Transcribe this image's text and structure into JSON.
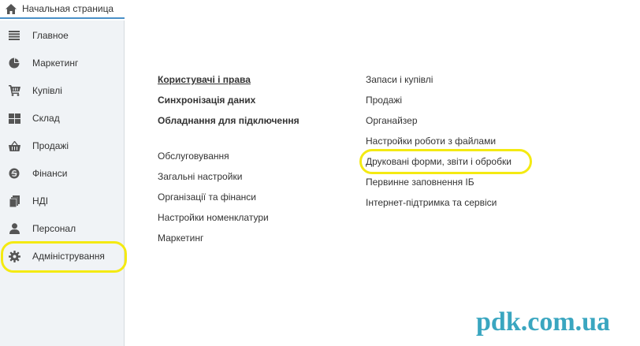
{
  "home_tab": {
    "label": "Начальная страница",
    "icon": "home-icon"
  },
  "sidebar": {
    "items": [
      {
        "label": "Главное",
        "icon": "menu-lines-icon"
      },
      {
        "label": "Маркетинг",
        "icon": "pie-chart-icon"
      },
      {
        "label": "Купівлі",
        "icon": "cart-icon"
      },
      {
        "label": "Склад",
        "icon": "grid-icon"
      },
      {
        "label": "Продажі",
        "icon": "basket-icon"
      },
      {
        "label": "Фінанси",
        "icon": "coin-icon"
      },
      {
        "label": "НДІ",
        "icon": "books-icon"
      },
      {
        "label": "Персонал",
        "icon": "person-icon"
      },
      {
        "label": "Адміністрування",
        "icon": "gear-icon"
      }
    ]
  },
  "main": {
    "col1_group1": [
      "Користувачі і права",
      "Синхронізація даних",
      "Обладнання для підключення"
    ],
    "col1_group2": [
      "Обслуговування",
      "Загальні настройки",
      "Організації та фінанси",
      "Настройки номенклатури",
      "Маркетинг"
    ],
    "col2": [
      "Запаси і купівлі",
      "Продажі",
      "Органайзер",
      "Настройки роботи з файлами",
      "Друковані форми, звіти і обробки",
      "Первинне заповнення ІБ",
      "Інтернет-підтримка та сервіси"
    ]
  },
  "watermark": "pdk.com.ua",
  "colors": {
    "highlight": "#f4ea12",
    "tab_underline": "#4a90c8",
    "sidebar_bg": "#f0f3f6",
    "watermark": "#3aa6c0"
  }
}
